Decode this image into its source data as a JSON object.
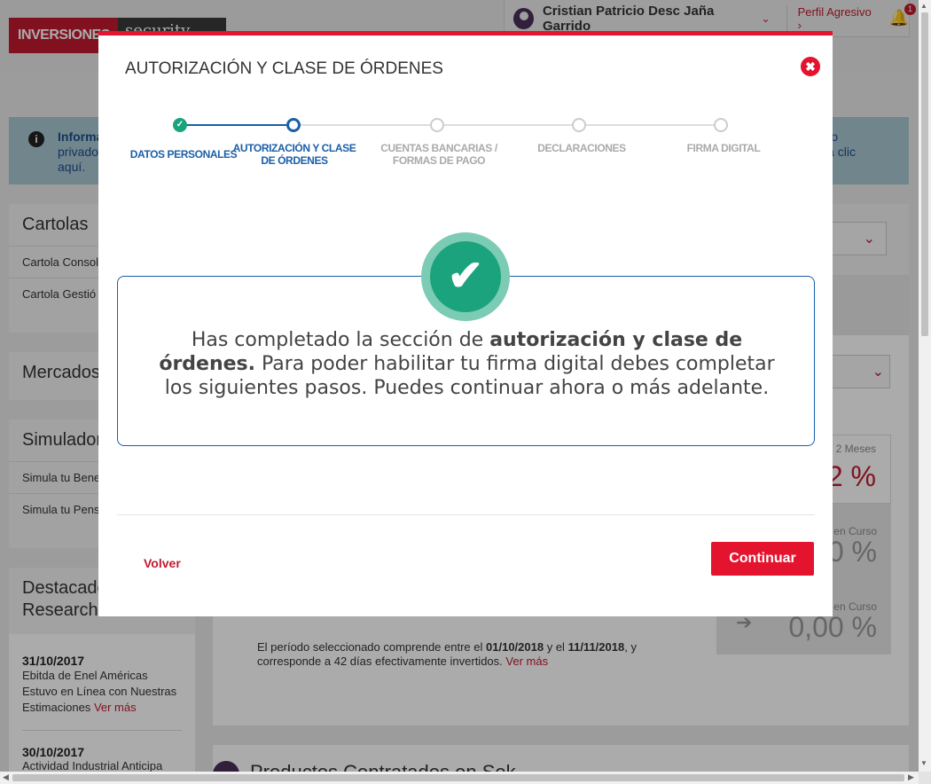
{
  "brand": {
    "part1": "INVERSIONES",
    "part2": "security"
  },
  "header": {
    "user_name": "Cristian Patricio Desc Jaña Garrido",
    "profile": "Perfil Agresivo",
    "notif_count": "1"
  },
  "info_banner": {
    "line1": "Informa",
    "line2": "privado",
    "line3": "aquí.",
    "right1": "o",
    "right2": "a clic"
  },
  "sidebar": {
    "cartolas": {
      "title": "Cartolas",
      "items": [
        "Cartola Consol",
        "Cartola Gestió"
      ]
    },
    "mercados": {
      "title": "Mercados"
    },
    "simuladores": {
      "title": "Simulador",
      "items": [
        "Simula tu Bene",
        "Simula tu Pens"
      ]
    },
    "destacados": {
      "title_line1": "Destacado",
      "title_line2": "Research"
    },
    "news": [
      {
        "date": "31/10/2017",
        "text": "Ebitda de Enel Américas Estuvo en Línea con Nuestras Estimaciones",
        "more": "Ver más"
      },
      {
        "date": "30/10/2017",
        "text": "Actividad Industrial Anticipa"
      }
    ]
  },
  "main": {
    "period_text1": "El período seleccionado comprende entre el",
    "date_from": "01/10/2018",
    "period_and": "y el",
    "date_to": "11/11/2018",
    "period_text2": ", y corresponde a 42 días efectivamente invertidos.",
    "more": "Ver más",
    "stats": [
      {
        "label": "2 Meses",
        "value": "2 %"
      },
      {
        "label": "en Curso",
        "value": "0 %"
      },
      {
        "label": "en Curso",
        "value": "0,00 %"
      }
    ],
    "bottom_title": "Productos Contratados en Sek"
  },
  "modal": {
    "title": "AUTORIZACIÓN Y CLASE DE ÓRDENES",
    "steps": [
      {
        "label": "DATOS PERSONALES",
        "state": "done"
      },
      {
        "label": "AUTORIZACIÓN Y CLASE DE ÓRDENES",
        "state": "active"
      },
      {
        "label": "CUENTAS BANCARIAS / FORMAS DE PAGO",
        "state": "pending"
      },
      {
        "label": "DECLARACIONES",
        "state": "pending"
      },
      {
        "label": "FIRMA DIGITAL",
        "state": "pending"
      }
    ],
    "message_pre": "Has completado la sección de ",
    "message_bold": "autorización y clase de órdenes.",
    "message_post": " Para poder habilitar tu firma digital debes completar los siguientes pasos. Puedes continuar ahora o más adelante.",
    "back_label": "Volver",
    "continue_label": "Continuar"
  },
  "colors": {
    "accent_red": "#e4132e",
    "step_blue": "#1a5fa8",
    "success_green": "#1aa37c"
  }
}
